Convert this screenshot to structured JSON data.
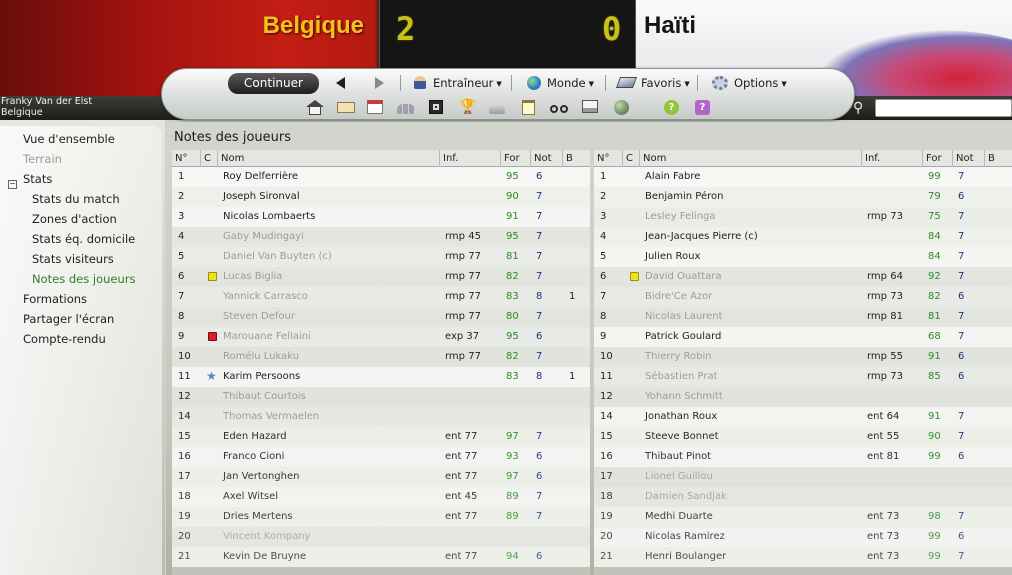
{
  "match": {
    "home_team": "Belgique",
    "away_team": "Haïti",
    "home_score": "2",
    "away_score": "0"
  },
  "manager": {
    "name": "Franky Van der Elst",
    "team": "Belgique"
  },
  "toolbar": {
    "continue_label": "Continuer",
    "menus": [
      {
        "label": "Entraîneur",
        "icon": "person-icon"
      },
      {
        "label": "Monde",
        "icon": "globe-icon"
      },
      {
        "label": "Favoris",
        "icon": "favorites-icon"
      },
      {
        "label": "Options",
        "icon": "gear-icon"
      }
    ],
    "icons": [
      "home-icon",
      "email-icon",
      "calendar-icon",
      "squad-icon",
      "tactics-icon",
      "trophy-icon",
      "scouting-icon",
      "clipboard-icon",
      "binoculars-icon",
      "news-icon",
      "world-icon",
      "help-icon",
      "question-icon"
    ]
  },
  "sidebar": {
    "items": [
      {
        "label": "Vue d'ensemble"
      },
      {
        "label": "Terrain"
      },
      {
        "label": "Stats"
      },
      {
        "label": "Stats du match"
      },
      {
        "label": "Zones d'action"
      },
      {
        "label": "Stats éq. domicile"
      },
      {
        "label": "Stats visiteurs"
      },
      {
        "label": "Notes des joueurs"
      },
      {
        "label": "Formations"
      },
      {
        "label": "Partager l'écran"
      },
      {
        "label": "Compte-rendu"
      }
    ]
  },
  "main": {
    "title": "Notes des joueurs",
    "columns": [
      "N°",
      "C",
      "Nom",
      "Inf.",
      "For",
      "Not",
      "B"
    ],
    "home_players": [
      {
        "n": "1",
        "name": "Roy Delferrière",
        "inf": "",
        "for": "95",
        "not": "6",
        "b": "",
        "out": false
      },
      {
        "n": "2",
        "name": "Joseph Sironval",
        "inf": "",
        "for": "90",
        "not": "7",
        "b": "",
        "out": false
      },
      {
        "n": "3",
        "name": "Nicolas Lombaerts",
        "inf": "",
        "for": "91",
        "not": "7",
        "b": "",
        "out": false
      },
      {
        "n": "4",
        "name": "Gaby Mudingayi",
        "inf": "rmp 45",
        "for": "95",
        "not": "7",
        "b": "",
        "out": true
      },
      {
        "n": "5",
        "name": "Daniel Van Buyten (c)",
        "inf": "rmp 77",
        "for": "81",
        "not": "7",
        "b": "",
        "out": true
      },
      {
        "n": "6",
        "name": "Lucas Biglia",
        "inf": "rmp 77",
        "for": "82",
        "not": "7",
        "b": "",
        "out": true,
        "card": "yellow"
      },
      {
        "n": "7",
        "name": "Yannick Carrasco",
        "inf": "rmp 77",
        "for": "83",
        "not": "8",
        "b": "1",
        "out": true
      },
      {
        "n": "8",
        "name": "Steven Defour",
        "inf": "rmp 77",
        "for": "80",
        "not": "7",
        "b": "",
        "out": true
      },
      {
        "n": "9",
        "name": "Marouane Fellaini",
        "inf": "exp 37",
        "for": "95",
        "not": "6",
        "b": "",
        "out": true,
        "card": "red"
      },
      {
        "n": "10",
        "name": "Romélu Lukaku",
        "inf": "rmp 77",
        "for": "82",
        "not": "7",
        "b": "",
        "out": true
      },
      {
        "n": "11",
        "name": "Karim Persoons",
        "inf": "",
        "for": "83",
        "not": "8",
        "b": "1",
        "out": false,
        "star": true
      },
      {
        "n": "12",
        "name": "Thibaut Courtois",
        "inf": "",
        "for": "",
        "not": "",
        "b": "",
        "out": true
      },
      {
        "n": "14",
        "name": "Thomas Vermaelen",
        "inf": "",
        "for": "",
        "not": "",
        "b": "",
        "out": true
      },
      {
        "n": "15",
        "name": "Eden Hazard",
        "inf": "ent 77",
        "for": "97",
        "not": "7",
        "b": "",
        "out": false
      },
      {
        "n": "16",
        "name": "Franco Cioni",
        "inf": "ent 77",
        "for": "93",
        "not": "6",
        "b": "",
        "out": false
      },
      {
        "n": "17",
        "name": "Jan Vertonghen",
        "inf": "ent 77",
        "for": "97",
        "not": "6",
        "b": "",
        "out": false
      },
      {
        "n": "18",
        "name": "Axel Witsel",
        "inf": "ent 45",
        "for": "89",
        "not": "7",
        "b": "",
        "out": false
      },
      {
        "n": "19",
        "name": "Dries Mertens",
        "inf": "ent 77",
        "for": "89",
        "not": "7",
        "b": "",
        "out": false
      },
      {
        "n": "20",
        "name": "Vincent Kompany",
        "inf": "",
        "for": "",
        "not": "",
        "b": "",
        "out": true
      },
      {
        "n": "21",
        "name": "Kevin De Bruyne",
        "inf": "ent 77",
        "for": "94",
        "not": "6",
        "b": "",
        "out": false
      }
    ],
    "away_players": [
      {
        "n": "1",
        "name": "Alain Fabre",
        "inf": "",
        "for": "99",
        "not": "7",
        "b": "",
        "out": false
      },
      {
        "n": "2",
        "name": "Benjamin Péron",
        "inf": "",
        "for": "79",
        "not": "6",
        "b": "",
        "out": false
      },
      {
        "n": "3",
        "name": "Lesley Felinga",
        "inf": "rmp 73",
        "for": "75",
        "not": "7",
        "b": "",
        "out": true
      },
      {
        "n": "4",
        "name": "Jean-Jacques Pierre (c)",
        "inf": "",
        "for": "84",
        "not": "7",
        "b": "",
        "out": false
      },
      {
        "n": "5",
        "name": "Julien Roux",
        "inf": "",
        "for": "84",
        "not": "7",
        "b": "",
        "out": false
      },
      {
        "n": "6",
        "name": "David Ouattara",
        "inf": "rmp 64",
        "for": "92",
        "not": "7",
        "b": "",
        "out": true,
        "card": "yellow"
      },
      {
        "n": "7",
        "name": "Bidre'Ce Azor",
        "inf": "rmp 73",
        "for": "82",
        "not": "6",
        "b": "",
        "out": true
      },
      {
        "n": "8",
        "name": "Nicolas Laurent",
        "inf": "rmp 81",
        "for": "81",
        "not": "7",
        "b": "",
        "out": true
      },
      {
        "n": "9",
        "name": "Patrick Goulard",
        "inf": "",
        "for": "68",
        "not": "7",
        "b": "",
        "out": false
      },
      {
        "n": "10",
        "name": "Thierry Robin",
        "inf": "rmp 55",
        "for": "91",
        "not": "6",
        "b": "",
        "out": true
      },
      {
        "n": "11",
        "name": "Sébastien Prat",
        "inf": "rmp 73",
        "for": "85",
        "not": "6",
        "b": "",
        "out": true
      },
      {
        "n": "12",
        "name": "Yohann Schmitt",
        "inf": "",
        "for": "",
        "not": "",
        "b": "",
        "out": true
      },
      {
        "n": "14",
        "name": "Jonathan Roux",
        "inf": "ent 64",
        "for": "91",
        "not": "7",
        "b": "",
        "out": false
      },
      {
        "n": "15",
        "name": "Steeve Bonnet",
        "inf": "ent 55",
        "for": "90",
        "not": "7",
        "b": "",
        "out": false
      },
      {
        "n": "16",
        "name": "Thibaut Pinot",
        "inf": "ent 81",
        "for": "99",
        "not": "6",
        "b": "",
        "out": false
      },
      {
        "n": "17",
        "name": "Lionel Guillou",
        "inf": "",
        "for": "",
        "not": "",
        "b": "",
        "out": true
      },
      {
        "n": "18",
        "name": "Damien Sandjak",
        "inf": "",
        "for": "",
        "not": "",
        "b": "",
        "out": true
      },
      {
        "n": "19",
        "name": "Medhi Duarte",
        "inf": "ent 73",
        "for": "98",
        "not": "7",
        "b": "",
        "out": false
      },
      {
        "n": "20",
        "name": "Nicolas Ramirez",
        "inf": "ent 73",
        "for": "99",
        "not": "6",
        "b": "",
        "out": false
      },
      {
        "n": "21",
        "name": "Henri Boulanger",
        "inf": "ent 73",
        "for": "99",
        "not": "7",
        "b": "",
        "out": false
      }
    ]
  },
  "colors": {
    "for": "#2d8a25",
    "not": "#20327a",
    "selected_nav": "#2f7d27",
    "home_name": "#f2c11c",
    "led": "#c9c11a"
  }
}
